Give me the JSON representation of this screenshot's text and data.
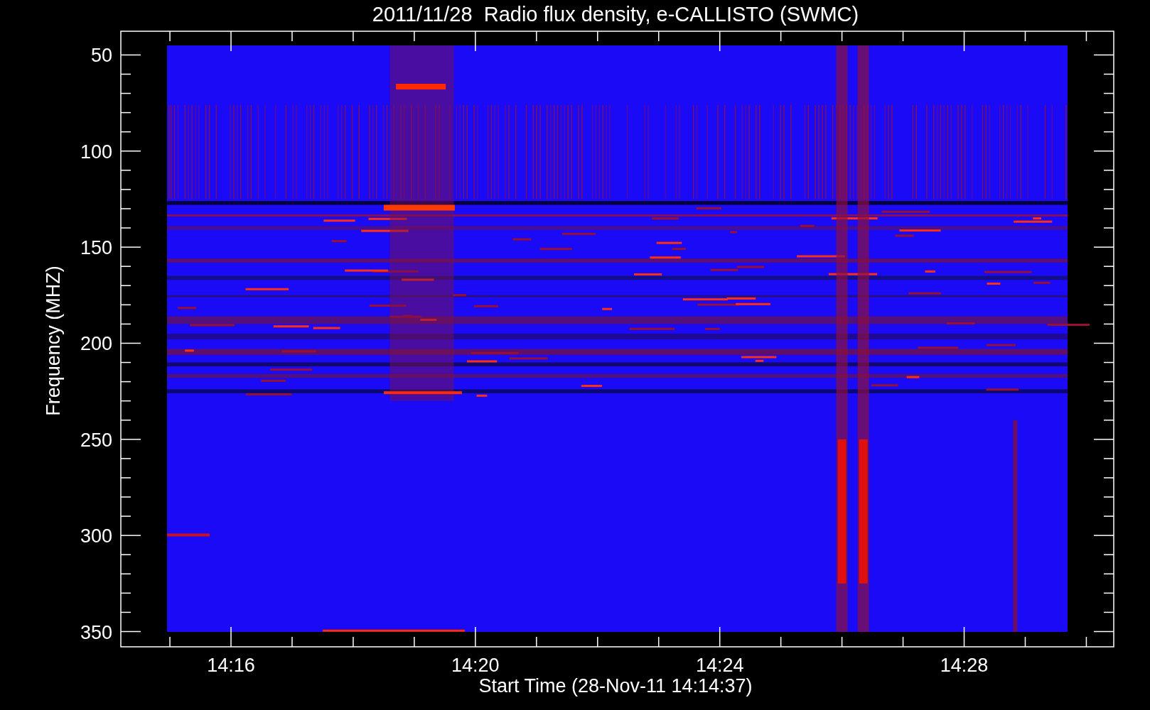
{
  "plot": {
    "title": "2011/11/28  Radio flux density, e-CALLISTO (SWMC)",
    "ylabel": "Frequency (MHZ)",
    "xlabel": "Start Time (28-Nov-11 14:14:37)",
    "y_tick_labels": [
      "50",
      "100",
      "150",
      "200",
      "250",
      "300",
      "350"
    ],
    "x_tick_labels": [
      "14:16",
      "14:20",
      "14:24",
      "14:28"
    ]
  }
}
